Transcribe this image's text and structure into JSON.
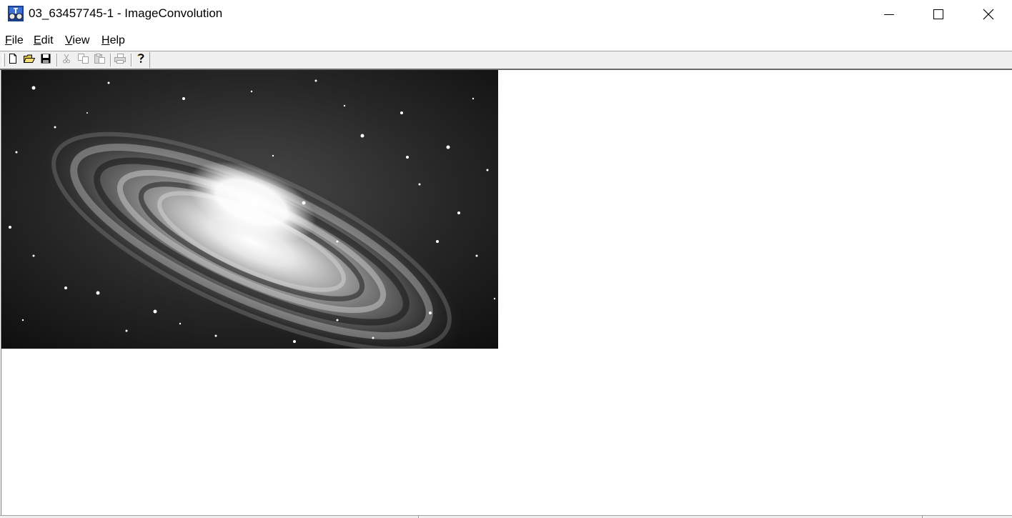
{
  "window": {
    "title": "03_63457745-1 - ImageConvolution",
    "icon": "app-icon",
    "controls": [
      "minimize-icon",
      "maximize-icon",
      "close-icon"
    ]
  },
  "menu": {
    "file": {
      "mnemonic": "F",
      "rest": "ile"
    },
    "edit": {
      "mnemonic": "E",
      "rest": "dit"
    },
    "view": {
      "mnemonic": "V",
      "rest": "iew"
    },
    "help": {
      "mnemonic": "H",
      "rest": "elp"
    }
  },
  "toolbar": {
    "buttons": [
      {
        "icon": "new-document-icon",
        "enabled": true
      },
      {
        "icon": "open-folder-icon",
        "enabled": true
      },
      {
        "icon": "save-disk-icon",
        "enabled": true
      },
      {
        "icon": "cut-icon",
        "enabled": false
      },
      {
        "icon": "copy-icon",
        "enabled": false
      },
      {
        "icon": "paste-icon",
        "enabled": false
      },
      {
        "icon": "print-icon",
        "enabled": false
      },
      {
        "icon": "help-icon",
        "enabled": true
      }
    ]
  },
  "document": {
    "image": "grayscale-spiral-galaxy"
  },
  "colors": {
    "toolbar_bg": "#f0f0f0",
    "client_bg": "#ffffff",
    "disabled_icon": "#a0a0a0"
  }
}
